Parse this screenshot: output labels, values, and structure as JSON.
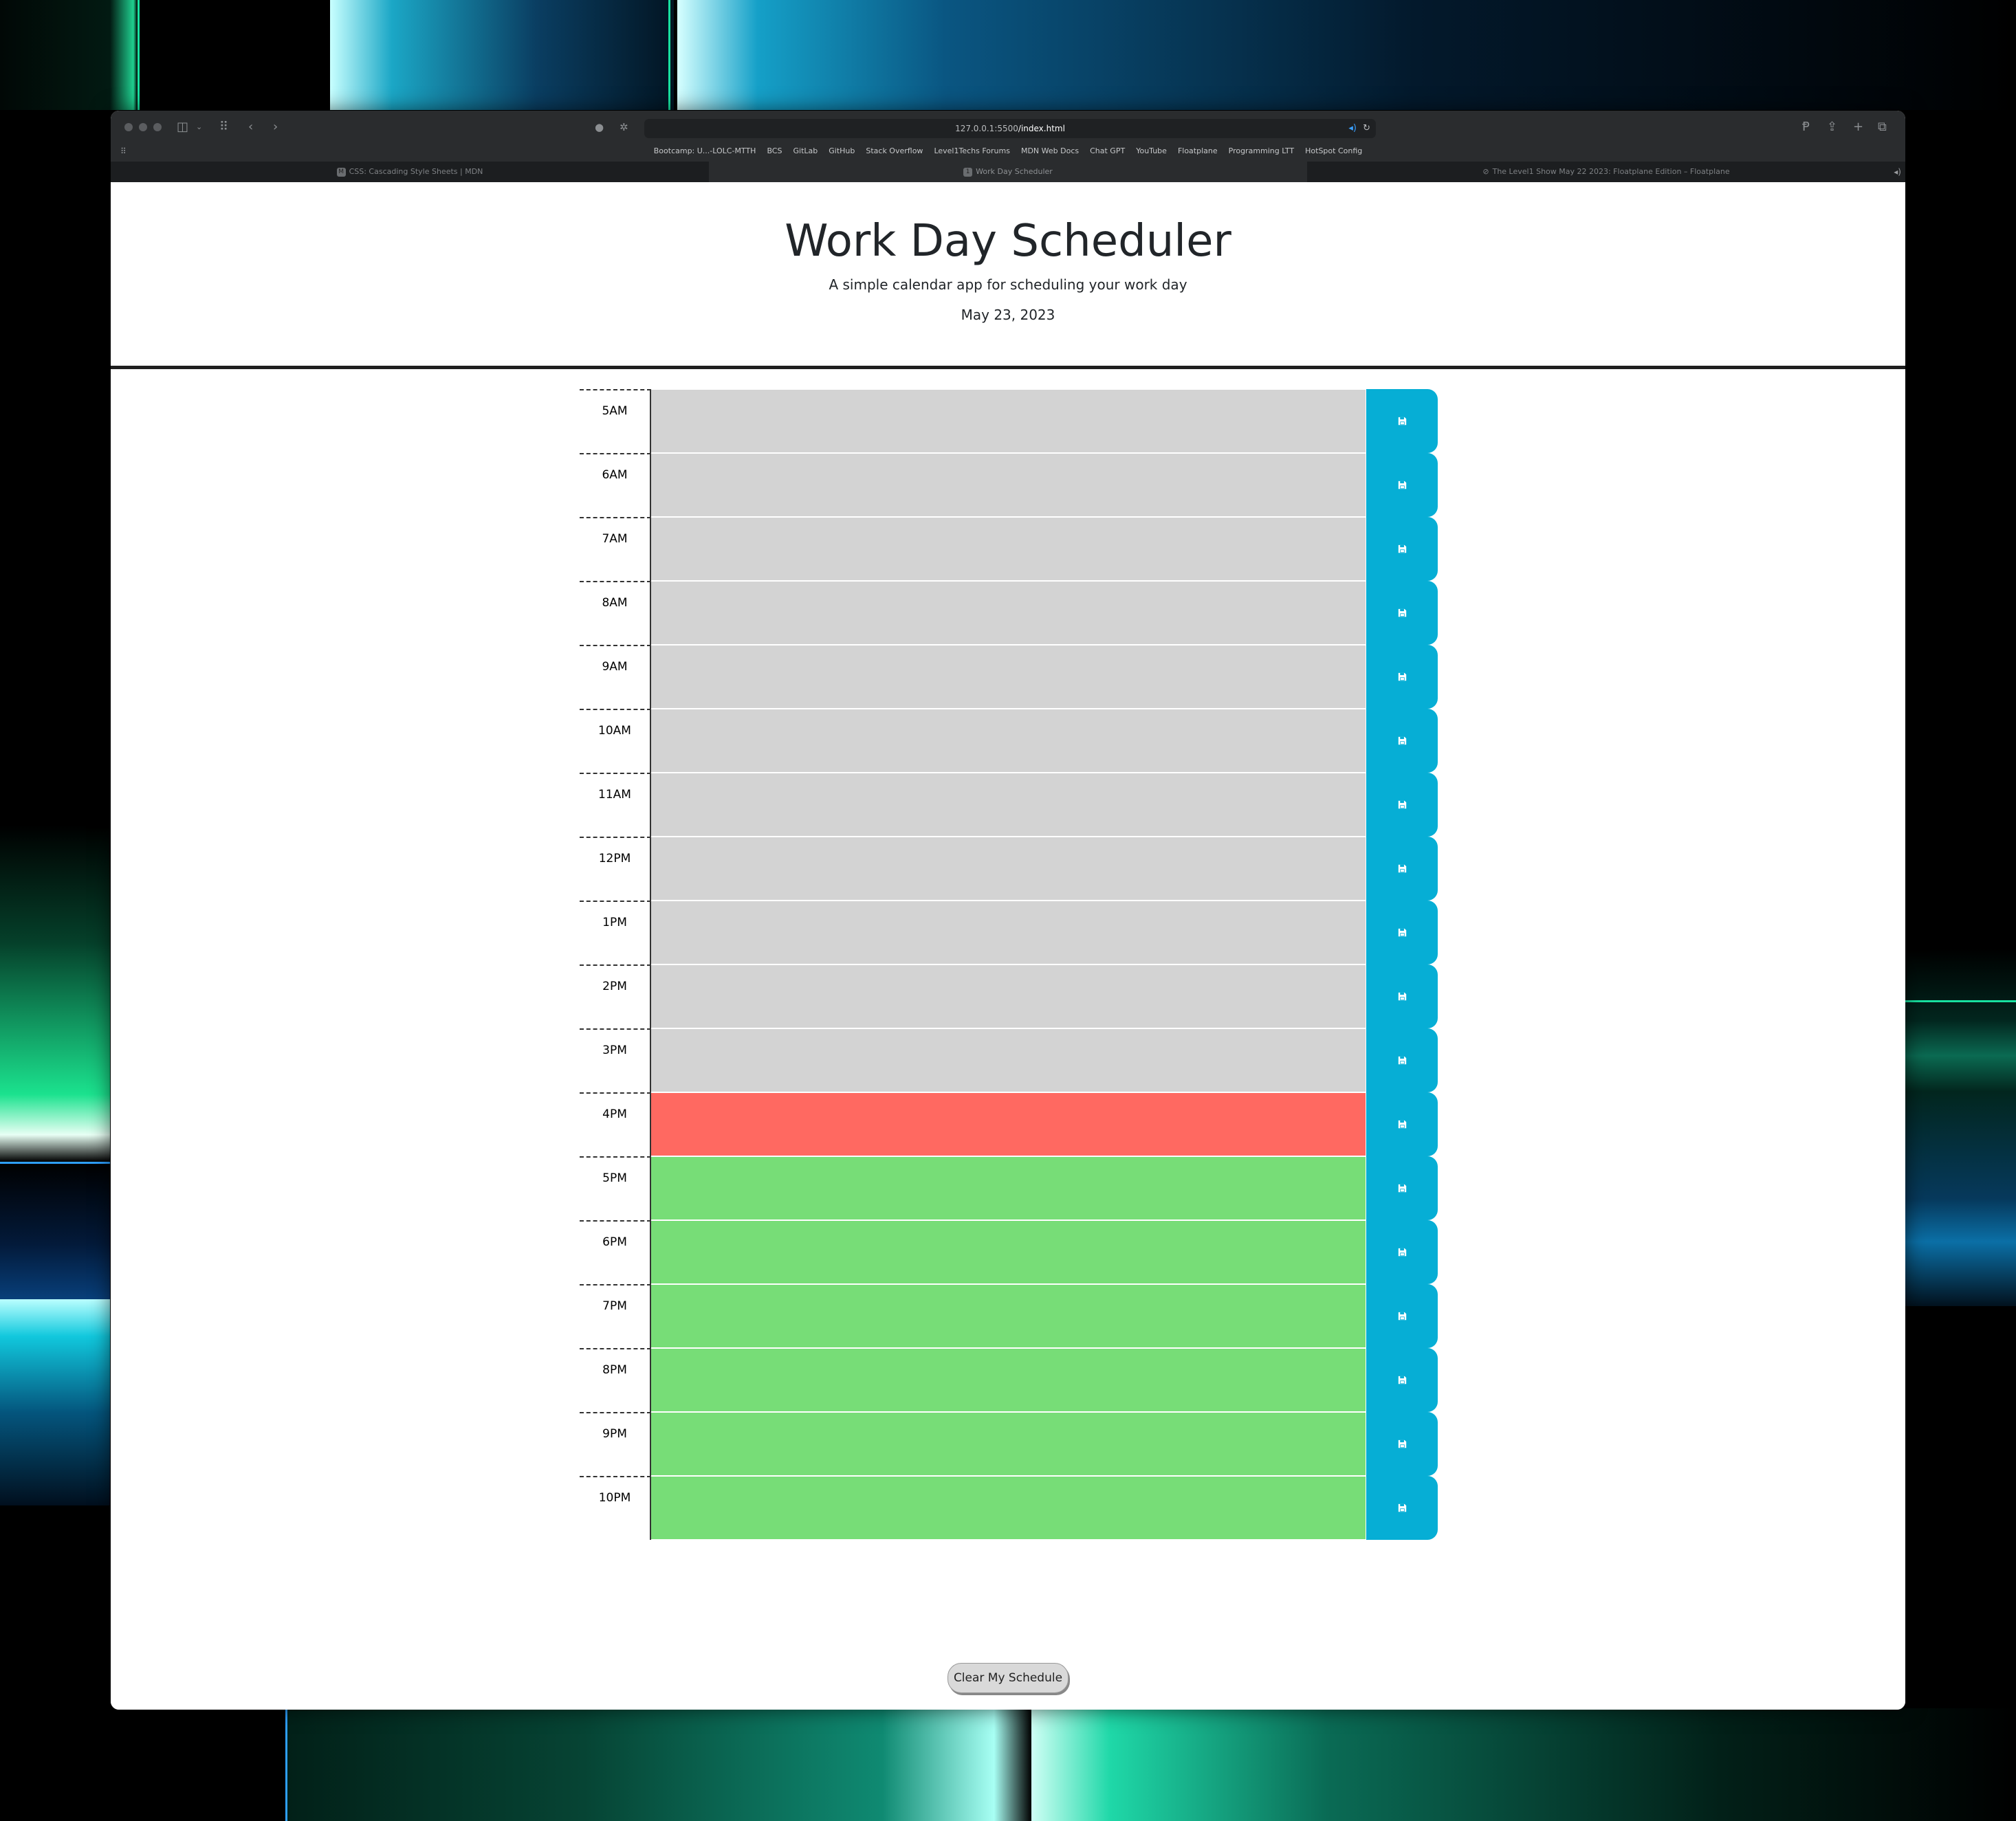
{
  "browser": {
    "url_host": "127.0.0.1:5500",
    "url_path": "/index.html",
    "bookmarks": [
      "Bootcamp: U...-LOLC-MTTH",
      "BCS",
      "GitLab",
      "GitHub",
      "Stack Overflow",
      "Level1Techs Forums",
      "MDN Web Docs",
      "Chat GPT",
      "YouTube",
      "Floatplane",
      "Programming LTT",
      "HotSpot Config"
    ],
    "tabs": [
      {
        "label": "CSS: Cascading Style Sheets | MDN",
        "favicon": "M",
        "active": false
      },
      {
        "label": "Work Day Scheduler",
        "favicon": "1",
        "active": true
      },
      {
        "label": "The Level1 Show May 22 2023: Floatplane Edition – Floatplane",
        "favicon": "",
        "active": false
      }
    ]
  },
  "header": {
    "title": "Work Day Scheduler",
    "subtitle": "A simple calendar app for scheduling your work day",
    "date": "May 23, 2023"
  },
  "schedule": {
    "rows": [
      {
        "hour": "5AM",
        "state": "past"
      },
      {
        "hour": "6AM",
        "state": "past"
      },
      {
        "hour": "7AM",
        "state": "past"
      },
      {
        "hour": "8AM",
        "state": "past"
      },
      {
        "hour": "9AM",
        "state": "past"
      },
      {
        "hour": "10AM",
        "state": "past"
      },
      {
        "hour": "11AM",
        "state": "past"
      },
      {
        "hour": "12PM",
        "state": "past"
      },
      {
        "hour": "1PM",
        "state": "past"
      },
      {
        "hour": "2PM",
        "state": "past"
      },
      {
        "hour": "3PM",
        "state": "past"
      },
      {
        "hour": "4PM",
        "state": "present"
      },
      {
        "hour": "5PM",
        "state": "future"
      },
      {
        "hour": "6PM",
        "state": "future"
      },
      {
        "hour": "7PM",
        "state": "future"
      },
      {
        "hour": "8PM",
        "state": "future"
      },
      {
        "hour": "9PM",
        "state": "future"
      },
      {
        "hour": "10PM",
        "state": "future"
      }
    ],
    "save_icon": "floppy-disk-icon",
    "clear_label": "Clear My Schedule"
  },
  "colors": {
    "past": "#d3d3d3",
    "present": "#ff6961",
    "future": "#77dd77",
    "save_button": "#06aed5"
  }
}
